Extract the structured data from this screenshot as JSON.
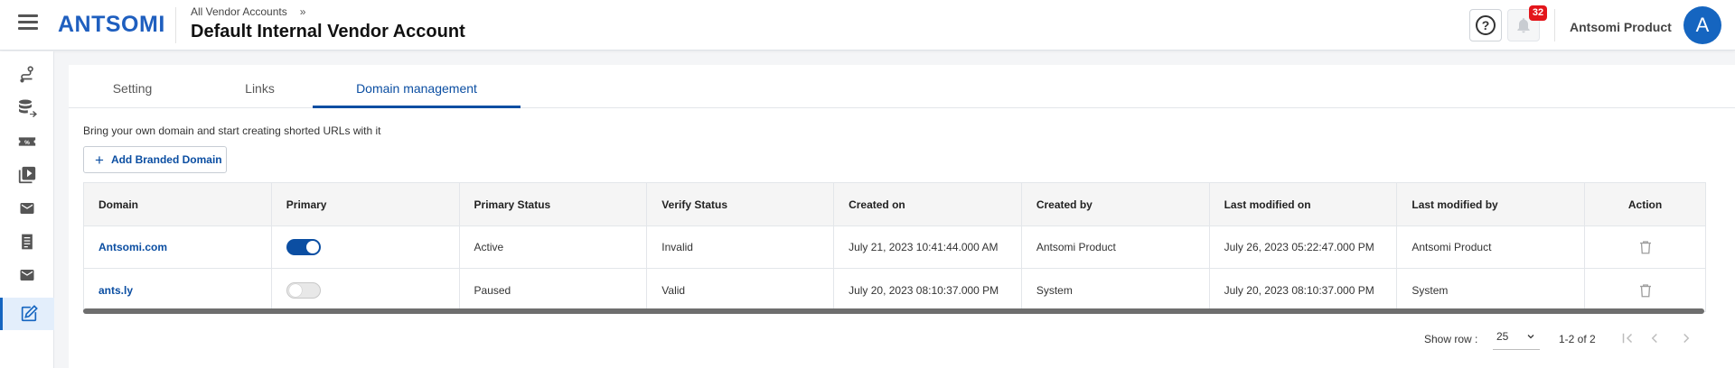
{
  "header": {
    "logo": "ANTSOMI",
    "breadcrumb_parent": "All Vendor Accounts",
    "breadcrumb_sep": "»",
    "title": "Default Internal Vendor Account",
    "help_icon": "question-circle-icon",
    "notification_count": "32",
    "account_name": "Antsomi Product",
    "avatar_initial": "A"
  },
  "sidebar": {
    "items": [
      {
        "icon": "route-icon"
      },
      {
        "icon": "database-export-icon"
      },
      {
        "icon": "ticket-icon"
      },
      {
        "icon": "video-library-icon"
      },
      {
        "icon": "mail-icon"
      },
      {
        "icon": "document-list-icon"
      },
      {
        "icon": "mail-alt-icon"
      },
      {
        "icon": "edit-note-icon",
        "active": true
      }
    ]
  },
  "tabs": [
    "Setting",
    "Links",
    "Domain management"
  ],
  "active_tab": "Domain management",
  "description": "Bring your own domain and start creating shorted URLs with it",
  "add_button_label": "Add Branded Domain",
  "table": {
    "columns": [
      "Domain",
      "Primary",
      "Primary Status",
      "Verify Status",
      "Created on",
      "Created by",
      "Last modified on",
      "Last modified by",
      "Action"
    ],
    "rows": [
      {
        "domain": "Antsomi.com",
        "primary": true,
        "primary_status": "Active",
        "verify_status": "Invalid",
        "created_on": "July 21, 2023 10:41:44.000 AM",
        "created_by": "Antsomi Product",
        "last_modified_on": "July 26, 2023 05:22:47.000 PM",
        "last_modified_by": "Antsomi Product"
      },
      {
        "domain": "ants.ly",
        "primary": false,
        "primary_status": "Paused",
        "verify_status": "Valid",
        "created_on": "July 20, 2023 08:10:37.000 PM",
        "created_by": "System",
        "last_modified_on": "July 20, 2023 08:10:37.000 PM",
        "last_modified_by": "System"
      }
    ]
  },
  "pagination": {
    "show_row_label": "Show row :",
    "rows_per_page": "25",
    "range": "1-2 of 2"
  },
  "colors": {
    "primary": "#0b4ea2",
    "badge": "#e3151a",
    "avatar": "#1565c0"
  }
}
